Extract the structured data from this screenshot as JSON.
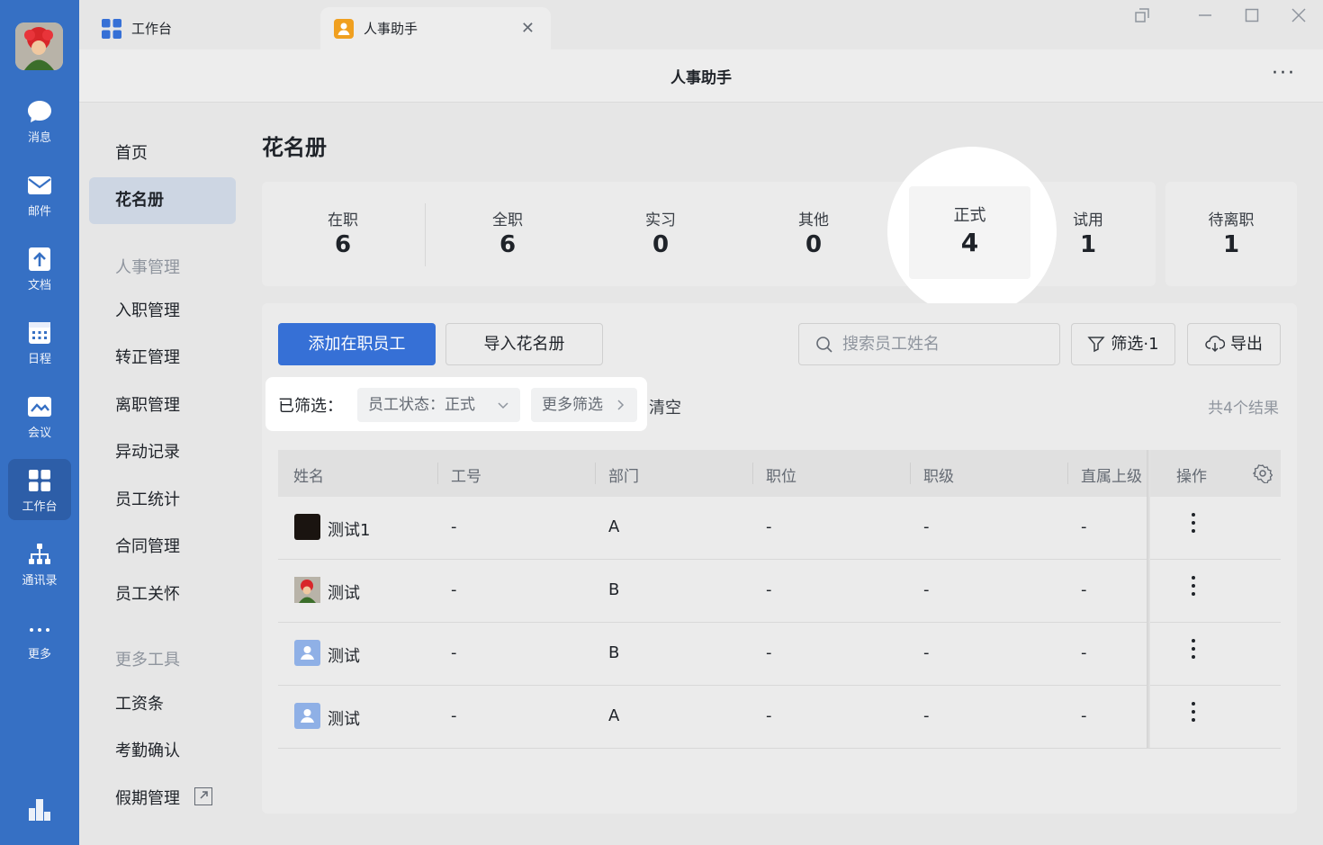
{
  "rail": {
    "items": [
      {
        "label": "消息",
        "icon": "chat-bubble-icon"
      },
      {
        "label": "邮件",
        "icon": "mail-icon"
      },
      {
        "label": "文档",
        "icon": "docs-icon"
      },
      {
        "label": "日程",
        "icon": "calendar-icon"
      },
      {
        "label": "会议",
        "icon": "meeting-icon"
      },
      {
        "label": "工作台",
        "icon": "workbench-icon",
        "active": true
      },
      {
        "label": "通讯录",
        "icon": "org-chart-icon"
      },
      {
        "label": "更多",
        "icon": "more-dots-icon"
      }
    ]
  },
  "tabs": [
    {
      "label": "工作台"
    },
    {
      "label": "人事助手"
    }
  ],
  "header": {
    "title": "人事助手"
  },
  "nav": {
    "home": "首页",
    "roster": "花名册",
    "group_hr": "人事管理",
    "onboarding": "入职管理",
    "regularization": "转正管理",
    "offboarding": "离职管理",
    "changes": "异动记录",
    "statistics": "员工统计",
    "contracts": "合同管理",
    "care": "员工关怀",
    "group_tools": "更多工具",
    "payslip": "工资条",
    "attendance": "考勤确认",
    "leave": "假期管理"
  },
  "page": {
    "title": "花名册"
  },
  "stats": [
    {
      "label": "在职",
      "value": "6"
    },
    {
      "label": "全职",
      "value": "6"
    },
    {
      "label": "实习",
      "value": "0"
    },
    {
      "label": "其他",
      "value": "0"
    },
    {
      "label": "正式",
      "value": "4"
    },
    {
      "label": "试用",
      "value": "1"
    },
    {
      "label": "待离职",
      "value": "1"
    }
  ],
  "toolbar": {
    "add": "添加在职员工",
    "import": "导入花名册",
    "search_placeholder": "搜索员工姓名",
    "filter": "筛选·1",
    "export": "导出"
  },
  "filters": {
    "label": "已筛选：",
    "status_chip": "员工状态：正式",
    "more_chip": "更多筛选",
    "clear": "清空",
    "result_count": "共4个结果"
  },
  "table": {
    "columns": [
      "姓名",
      "工号",
      "部门",
      "职位",
      "职级",
      "直属上级",
      "操作"
    ],
    "rows": [
      {
        "name": "测试1",
        "id": "-",
        "dept": "A",
        "position": "-",
        "level": "-",
        "manager": "-"
      },
      {
        "name": "测试",
        "id": "-",
        "dept": "B",
        "position": "-",
        "level": "-",
        "manager": "-"
      },
      {
        "name": "测试",
        "id": "-",
        "dept": "B",
        "position": "-",
        "level": "-",
        "manager": "-"
      },
      {
        "name": "测试",
        "id": "-",
        "dept": "A",
        "position": "-",
        "level": "-",
        "manager": "-"
      }
    ]
  },
  "colors": {
    "rail": "#3670c4",
    "primary": "#3670d6"
  }
}
